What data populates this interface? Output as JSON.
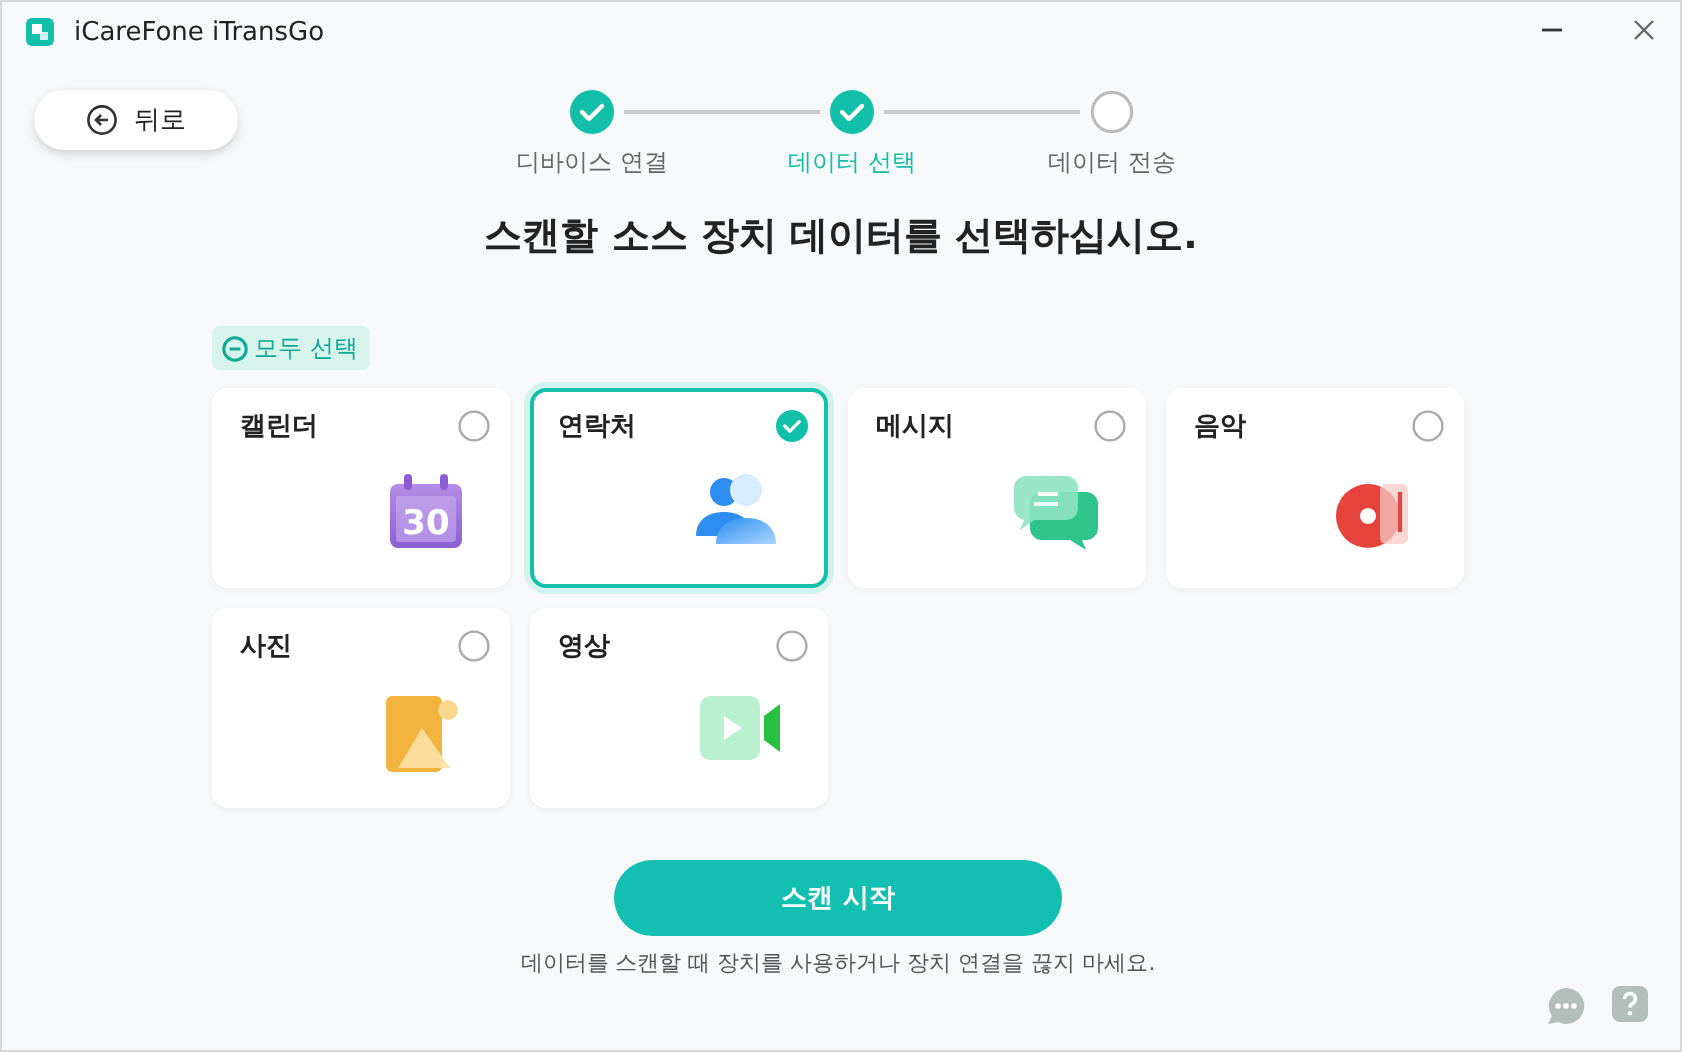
{
  "window": {
    "title": "iCareFone iTransGo"
  },
  "back_button": {
    "label": "뒤로"
  },
  "steps": [
    {
      "label": "디바이스 연결",
      "done": true,
      "selected": false
    },
    {
      "label": "데이터 선택",
      "done": true,
      "selected": true
    },
    {
      "label": "데이터 전송",
      "done": false,
      "selected": false
    }
  ],
  "heading": "스캔할 소스 장치 데이터를 선택하십시오.",
  "select_all": {
    "label": "모두 선택"
  },
  "categories": [
    {
      "label": "캘린더",
      "kind": "calendar",
      "selected": false,
      "icon_text": "30"
    },
    {
      "label": "연락처",
      "kind": "contacts",
      "selected": true
    },
    {
      "label": "메시지",
      "kind": "messages",
      "selected": false
    },
    {
      "label": "음악",
      "kind": "music",
      "selected": false
    },
    {
      "label": "사진",
      "kind": "photos",
      "selected": false
    },
    {
      "label": "영상",
      "kind": "video",
      "selected": false
    }
  ],
  "scan_button": {
    "label": "스캔 시작"
  },
  "note": "데이터를 스캔할 때 장치를 사용하거나 장치 연결을 끊지 마세요."
}
